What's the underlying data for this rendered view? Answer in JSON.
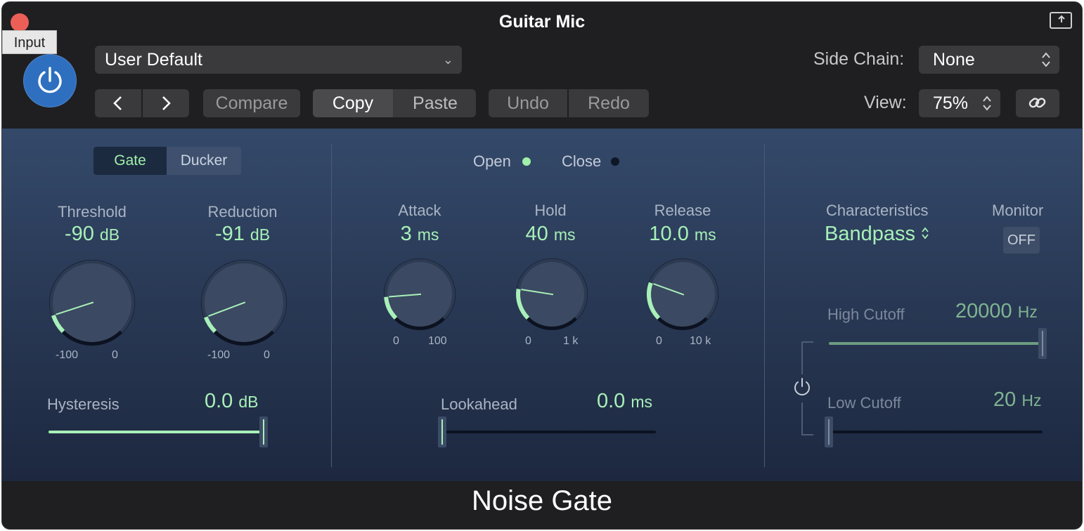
{
  "window": {
    "title": "Guitar Mic",
    "footer_title": "Noise Gate"
  },
  "tooltip": "Input",
  "header": {
    "preset": "User Default",
    "compare": "Compare",
    "copy": "Copy",
    "paste": "Paste",
    "undo": "Undo",
    "redo": "Redo",
    "side_chain_label": "Side Chain:",
    "side_chain_value": "None",
    "view_label": "View:",
    "view_value": "75%"
  },
  "mode": {
    "gate": "Gate",
    "ducker": "Ducker",
    "selected": "Gate"
  },
  "indicators": {
    "open": "Open",
    "close": "Close",
    "open_color": "#9ff0a8",
    "close_color": "#0e1726"
  },
  "knobs": {
    "threshold": {
      "label": "Threshold",
      "value": "-90",
      "unit": "dB",
      "min": "-100",
      "max": "0",
      "fraction": 0.1
    },
    "reduction": {
      "label": "Reduction",
      "value": "-91",
      "unit": "dB",
      "min": "-100",
      "max": "0",
      "fraction": 0.09
    },
    "attack": {
      "label": "Attack",
      "value": "3",
      "unit": "ms",
      "min": "0",
      "max": "100",
      "fraction": 0.15
    },
    "hold": {
      "label": "Hold",
      "value": "40",
      "unit": "ms",
      "min": "0",
      "max": "1 k",
      "fraction": 0.2
    },
    "release": {
      "label": "Release",
      "value": "10.0",
      "unit": "ms",
      "min": "0",
      "max": "10 k",
      "fraction": 0.24
    }
  },
  "sliders": {
    "hysteresis": {
      "label": "Hysteresis",
      "value": "0.0",
      "unit": "dB",
      "fraction": 1.0
    },
    "lookahead": {
      "label": "Lookahead",
      "value": "0.0",
      "unit": "ms",
      "fraction": 0.0
    },
    "high_cutoff": {
      "label": "High Cutoff",
      "value": "20000",
      "unit": "Hz",
      "fraction": 1.0
    },
    "low_cutoff": {
      "label": "Low Cutoff",
      "value": "20",
      "unit": "Hz",
      "fraction": 0.0
    }
  },
  "filter": {
    "characteristics_label": "Characteristics",
    "characteristics_value": "Bandpass",
    "monitor_label": "Monitor",
    "monitor_value": "OFF"
  },
  "colors": {
    "accent": "#a8f0b8",
    "power": "#2f6fbf",
    "panel_top": "#34496a",
    "panel_bottom": "#1d2840"
  }
}
